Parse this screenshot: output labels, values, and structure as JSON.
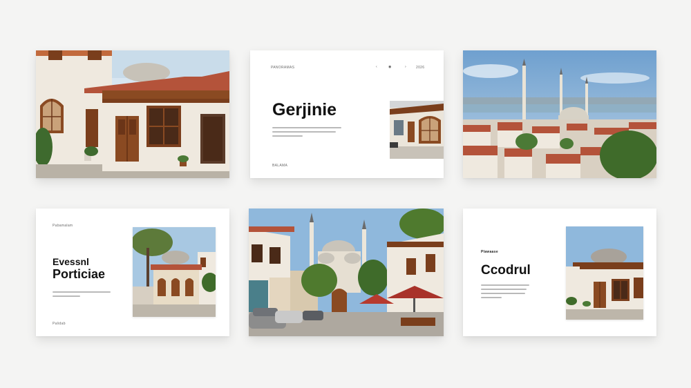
{
  "slides": {
    "top_left": {
      "alt": "Ottoman style house photo"
    },
    "top_center": {
      "header_left": "PANORAMAS",
      "nav_left": "‹",
      "nav_mid": "◉",
      "nav_right": "›",
      "page": "2026",
      "title": "Gerjinie",
      "footer": "BALAMA"
    },
    "top_right": {
      "alt": "Istanbul skyline with minarets"
    },
    "bottom_left": {
      "header": "Pabamalam",
      "title_line1": "Evessnl",
      "title_line2": "Porticiae",
      "footer": "Palidab"
    },
    "bottom_center": {
      "alt": "Mosque street with cafe umbrellas"
    },
    "bottom_right": {
      "header": "Plawaase",
      "title": "Ccodrul"
    }
  },
  "colors": {
    "background": "#f4f4f3",
    "card": "#ffffff",
    "title": "#111111",
    "terracotta": "#b4533a",
    "wood": "#7a3e1c",
    "sky": "#9cc1de"
  }
}
